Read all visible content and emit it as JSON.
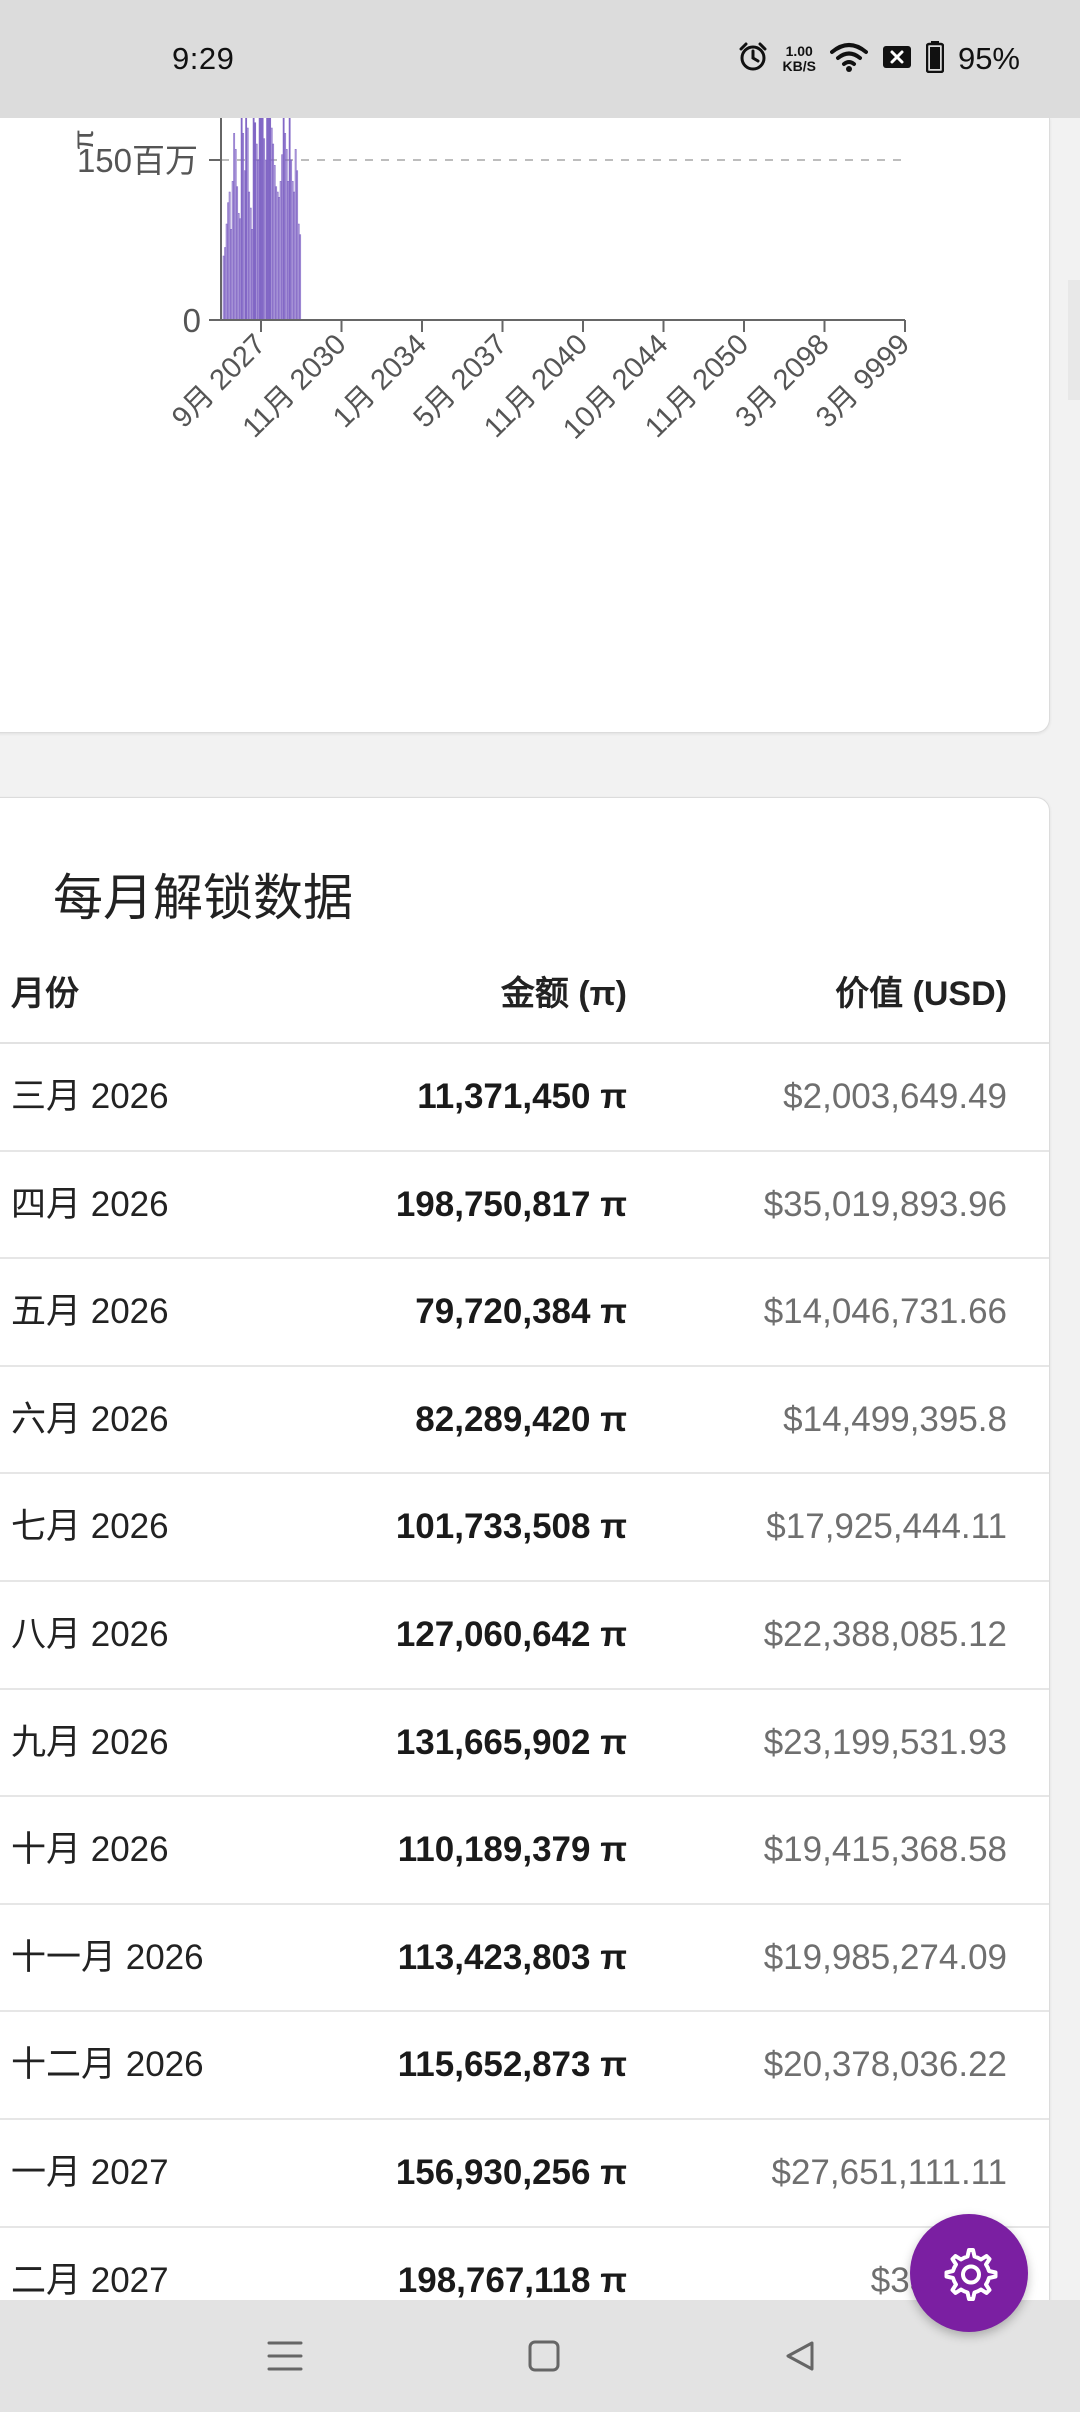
{
  "status_bar": {
    "time": "9:29",
    "speed_value": "1.00",
    "speed_unit": "KB/S",
    "battery": "95%",
    "icons": [
      "alarm-icon",
      "wifi-icon",
      "notification-x-icon",
      "battery-icon"
    ]
  },
  "chart_data": {
    "type": "bar",
    "ylabel_fragment": "π",
    "y_tick_labels": [
      "150百万",
      "0"
    ],
    "x_tick_labels": [
      "9月 2027",
      "11月 2030",
      "1月 2034",
      "5月 2037",
      "11月 2040",
      "10月 2044",
      "11月 2050",
      "3月 2098",
      "3月 9999"
    ],
    "bar_color": "#7e62c4",
    "values_in_millions": [
      60,
      68,
      90,
      110,
      120,
      85,
      130,
      175,
      160,
      125,
      100,
      95,
      190,
      175,
      140,
      200,
      180,
      120,
      105,
      85,
      190,
      185,
      165,
      150,
      210,
      200,
      195,
      170,
      150,
      200,
      210,
      230,
      180,
      165,
      145,
      125,
      120,
      115,
      130,
      155,
      200,
      175,
      160,
      130,
      210,
      150,
      130,
      120,
      160,
      140,
      90,
      80
    ]
  },
  "table": {
    "title": "每月解锁数据",
    "headers": {
      "month": "月份",
      "amount": "金额 (π)",
      "value": "价值 (USD)"
    },
    "rows": [
      {
        "month": "三月 2026",
        "amount": "11,371,450 π",
        "value": "$2,003,649.49"
      },
      {
        "month": "四月 2026",
        "amount": "198,750,817 π",
        "value": "$35,019,893.96"
      },
      {
        "month": "五月 2026",
        "amount": "79,720,384 π",
        "value": "$14,046,731.66"
      },
      {
        "month": "六月 2026",
        "amount": "82,289,420 π",
        "value": "$14,499,395.8"
      },
      {
        "month": "七月 2026",
        "amount": "101,733,508 π",
        "value": "$17,925,444.11"
      },
      {
        "month": "八月 2026",
        "amount": "127,060,642 π",
        "value": "$22,388,085.12"
      },
      {
        "month": "九月 2026",
        "amount": "131,665,902 π",
        "value": "$23,199,531.93"
      },
      {
        "month": "十月 2026",
        "amount": "110,189,379 π",
        "value": "$19,415,368.58"
      },
      {
        "month": "十一月 2026",
        "amount": "113,423,803 π",
        "value": "$19,985,274.09"
      },
      {
        "month": "十二月 2026",
        "amount": "115,652,873 π",
        "value": "$20,378,036.22"
      },
      {
        "month": "一月 2027",
        "amount": "156,930,256 π",
        "value": "$27,651,111.11"
      },
      {
        "month": "二月 2027",
        "amount": "198,767,118 π",
        "value": "$35,022,"
      }
    ]
  },
  "fab": {
    "icon": "gear-icon",
    "color": "#7b1fa2"
  },
  "nav_bar": {
    "icons": [
      "menu-icon",
      "home-icon",
      "back-icon"
    ]
  }
}
